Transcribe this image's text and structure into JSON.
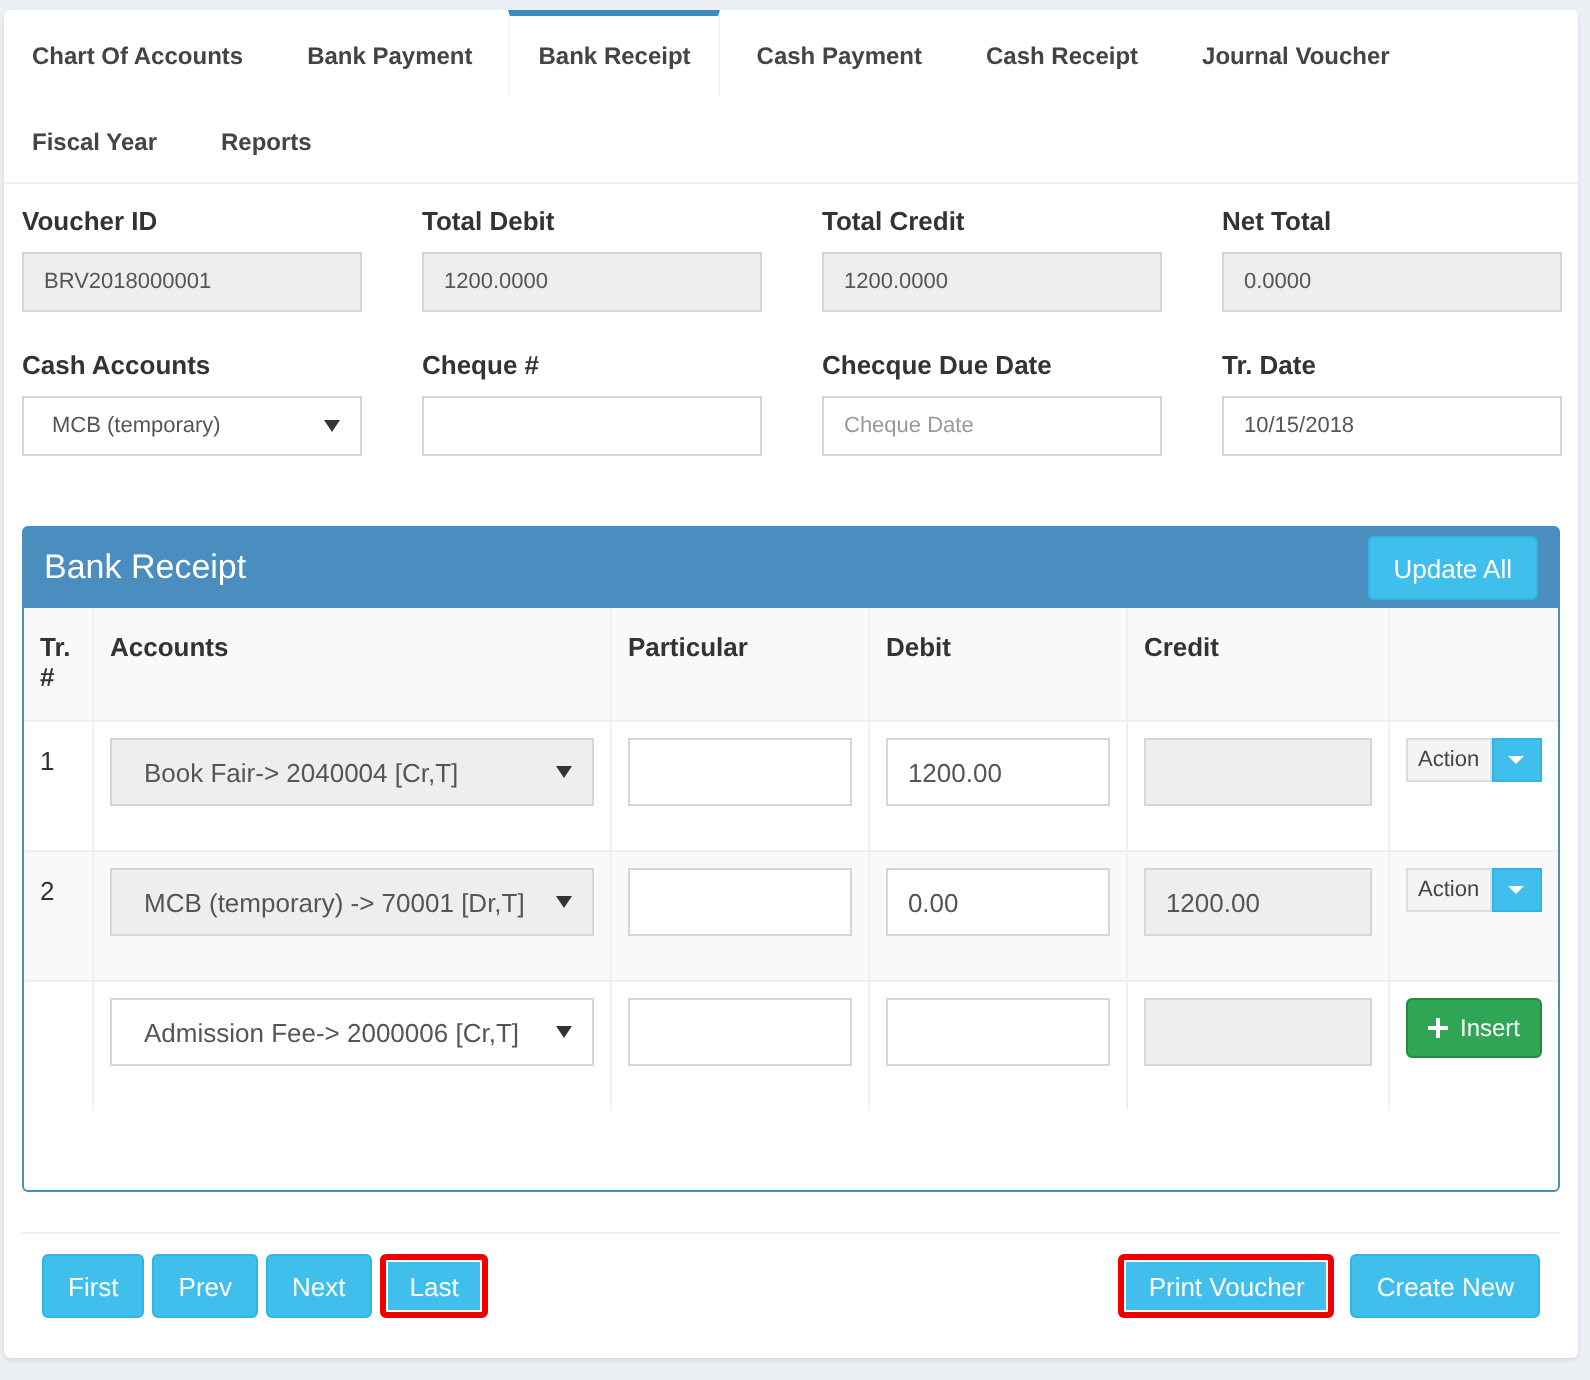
{
  "tabs": [
    {
      "label": "Chart Of Accounts",
      "selected": false
    },
    {
      "label": "Bank Payment",
      "selected": false
    },
    {
      "label": "Bank Receipt",
      "selected": true
    },
    {
      "label": "Cash Payment",
      "selected": false
    },
    {
      "label": "Cash Receipt",
      "selected": false
    },
    {
      "label": "Journal Voucher",
      "selected": false
    },
    {
      "label": "Fiscal Year",
      "selected": false
    },
    {
      "label": "Reports",
      "selected": false
    }
  ],
  "fields": [
    {
      "label": "Voucher ID",
      "kind": "readonly",
      "value": "BRV2018000001"
    },
    {
      "label": "Total Debit",
      "kind": "readonly",
      "value": "1200.0000"
    },
    {
      "label": "Total Credit",
      "kind": "readonly",
      "value": "1200.0000"
    },
    {
      "label": "Net Total",
      "kind": "readonly",
      "value": "0.0000"
    },
    {
      "label": "Cash Accounts",
      "kind": "select",
      "value": "MCB (temporary)"
    },
    {
      "label": "Cheque #",
      "kind": "text"
    },
    {
      "label": "Checque Due Date",
      "kind": "text",
      "placeholder": "Cheque Date"
    },
    {
      "label": "Tr. Date",
      "kind": "text",
      "value": "10/15/2018"
    }
  ],
  "panel": {
    "title": "Bank Receipt",
    "update_button": "Update All",
    "columns": [
      "Tr. #",
      "Accounts",
      "Particular",
      "Debit",
      "Credit"
    ],
    "rows": [
      {
        "number": "1",
        "account": "Book Fair-> 2040004 [Cr,T]",
        "account_disabled": true,
        "debit": "1200.00",
        "action": {
          "kind": "action",
          "label": "Action"
        }
      },
      {
        "number": "2",
        "account": "MCB (temporary) -> 70001 [Dr,T]",
        "account_disabled": true,
        "debit": "0.00",
        "credit": "1200.00",
        "action": {
          "kind": "action",
          "label": "Action"
        }
      },
      {
        "account": "Admission Fee-> 2000006 [Cr,T]",
        "account_disabled": false,
        "action": {
          "kind": "insert",
          "label": "Insert"
        }
      }
    ]
  },
  "nav_buttons": [
    {
      "label": "First",
      "highlighted": false
    },
    {
      "label": "Prev",
      "highlighted": false
    },
    {
      "label": "Next",
      "highlighted": false
    },
    {
      "label": "Last",
      "highlighted": true
    }
  ],
  "action_buttons": [
    {
      "label": "Print Voucher",
      "highlighted": true
    },
    {
      "label": "Create New",
      "highlighted": false
    }
  ]
}
